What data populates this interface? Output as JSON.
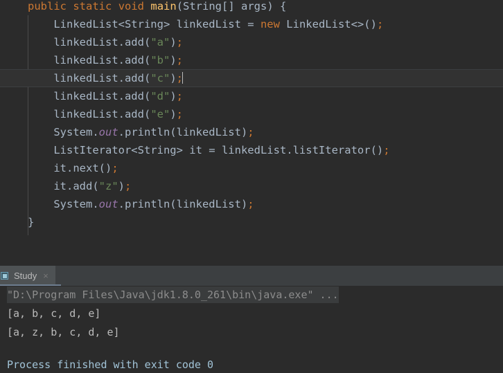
{
  "editor": {
    "language": "java",
    "current_line_index": 4,
    "caret_visible": true,
    "colors": {
      "background": "#2b2b2b",
      "current_line_background": "#323232",
      "default_text": "#a9b7c6",
      "keyword": "#cc7832",
      "method_declaration": "#ffc66d",
      "string_literal": "#6a8759",
      "semicolon": "#cc7832",
      "static_field": "#9876aa",
      "indent_guide": "#4b4b4b"
    },
    "lines": [
      {
        "indent": 0,
        "tokens": [
          {
            "t": "public",
            "c": "kw"
          },
          {
            "t": " ",
            "c": "plain"
          },
          {
            "t": "static",
            "c": "kw"
          },
          {
            "t": " ",
            "c": "plain"
          },
          {
            "t": "void",
            "c": "kw"
          },
          {
            "t": " ",
            "c": "plain"
          },
          {
            "t": "main",
            "c": "meth"
          },
          {
            "t": "(String[] args) {",
            "c": "plain"
          }
        ]
      },
      {
        "indent": 1,
        "tokens": [
          {
            "t": "LinkedList<String> linkedList = ",
            "c": "plain"
          },
          {
            "t": "new",
            "c": "kw"
          },
          {
            "t": " LinkedList<>()",
            "c": "plain"
          },
          {
            "t": ";",
            "c": "semi"
          }
        ]
      },
      {
        "indent": 1,
        "tokens": [
          {
            "t": "linkedList.add(",
            "c": "plain"
          },
          {
            "t": "\"a\"",
            "c": "str"
          },
          {
            "t": ")",
            "c": "plain"
          },
          {
            "t": ";",
            "c": "semi"
          }
        ]
      },
      {
        "indent": 1,
        "tokens": [
          {
            "t": "linkedList.add(",
            "c": "plain"
          },
          {
            "t": "\"b\"",
            "c": "str"
          },
          {
            "t": ")",
            "c": "plain"
          },
          {
            "t": ";",
            "c": "semi"
          }
        ]
      },
      {
        "indent": 1,
        "tokens": [
          {
            "t": "linkedList.add(",
            "c": "plain"
          },
          {
            "t": "\"c\"",
            "c": "str"
          },
          {
            "t": ")",
            "c": "plain"
          },
          {
            "t": ";",
            "c": "semi"
          }
        ]
      },
      {
        "indent": 1,
        "tokens": [
          {
            "t": "linkedList.add(",
            "c": "plain"
          },
          {
            "t": "\"d\"",
            "c": "str"
          },
          {
            "t": ")",
            "c": "plain"
          },
          {
            "t": ";",
            "c": "semi"
          }
        ]
      },
      {
        "indent": 1,
        "tokens": [
          {
            "t": "linkedList.add(",
            "c": "plain"
          },
          {
            "t": "\"e\"",
            "c": "str"
          },
          {
            "t": ")",
            "c": "plain"
          },
          {
            "t": ";",
            "c": "semi"
          }
        ]
      },
      {
        "indent": 1,
        "tokens": [
          {
            "t": "System.",
            "c": "plain"
          },
          {
            "t": "out",
            "c": "fld"
          },
          {
            "t": ".println(linkedList)",
            "c": "plain"
          },
          {
            "t": ";",
            "c": "semi"
          }
        ]
      },
      {
        "indent": 1,
        "tokens": [
          {
            "t": "ListIterator<String> it = linkedList.listIterator()",
            "c": "plain"
          },
          {
            "t": ";",
            "c": "semi"
          }
        ]
      },
      {
        "indent": 1,
        "tokens": [
          {
            "t": "it.next()",
            "c": "plain"
          },
          {
            "t": ";",
            "c": "semi"
          }
        ]
      },
      {
        "indent": 1,
        "tokens": [
          {
            "t": "it.add(",
            "c": "plain"
          },
          {
            "t": "\"z\"",
            "c": "str"
          },
          {
            "t": ")",
            "c": "plain"
          },
          {
            "t": ";",
            "c": "semi"
          }
        ]
      },
      {
        "indent": 1,
        "tokens": [
          {
            "t": "System.",
            "c": "plain"
          },
          {
            "t": "out",
            "c": "fld"
          },
          {
            "t": ".println(linkedList)",
            "c": "plain"
          },
          {
            "t": ";",
            "c": "semi"
          }
        ]
      },
      {
        "indent": 0,
        "tokens": [
          {
            "t": "}",
            "c": "brace"
          }
        ]
      },
      {
        "indent": 0,
        "tokens": []
      },
      {
        "indent": 0,
        "tokens": []
      },
      {
        "indent": 0,
        "tokens": [
          {
            "t": "}",
            "c": "brace"
          }
        ]
      }
    ]
  },
  "run_panel": {
    "tab": {
      "label": "Study",
      "icon": "run-configuration-icon",
      "close_label": "×",
      "active": true,
      "underline_color": "#6e7e91"
    },
    "console": {
      "lines": [
        {
          "text": "\"D:\\Program Files\\Java\\jdk1.8.0_261\\bin\\java.exe\" ...",
          "kind": "command"
        },
        {
          "text": "[a, b, c, d, e]",
          "kind": "stdout"
        },
        {
          "text": "[a, z, b, c, d, e]",
          "kind": "stdout"
        },
        {
          "text": "",
          "kind": "blank"
        },
        {
          "text": "Process finished with exit code 0",
          "kind": "exit"
        }
      ]
    }
  }
}
